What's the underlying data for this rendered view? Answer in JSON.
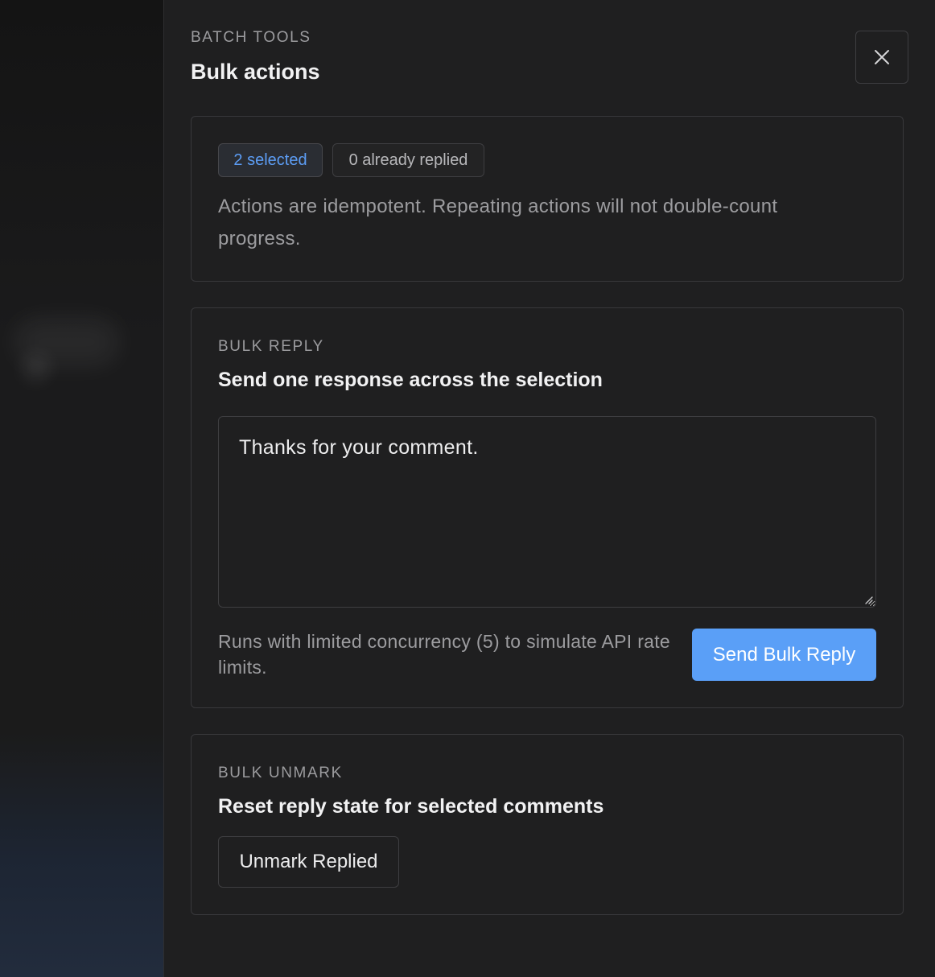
{
  "drawer": {
    "eyebrow": "BATCH TOOLS",
    "title": "Bulk actions",
    "close_icon": "close-icon"
  },
  "summary": {
    "selected_badge": "2 selected",
    "replied_badge": "0 already replied",
    "note": "Actions are idempotent. Repeating actions will not double-count progress."
  },
  "bulk_reply": {
    "eyebrow": "BULK REPLY",
    "title": "Send one response across the selection",
    "textarea_value": "Thanks for your comment.",
    "hint": "Runs with limited concurrency (5) to simulate API rate limits.",
    "send_label": "Send Bulk Reply"
  },
  "bulk_unmark": {
    "eyebrow": "BULK UNMARK",
    "title": "Reset reply state for selected comments",
    "unmark_label": "Unmark Replied"
  },
  "colors": {
    "accent": "#5a9ff7",
    "panel_bg": "#1f1f20",
    "border": "#38383b"
  }
}
